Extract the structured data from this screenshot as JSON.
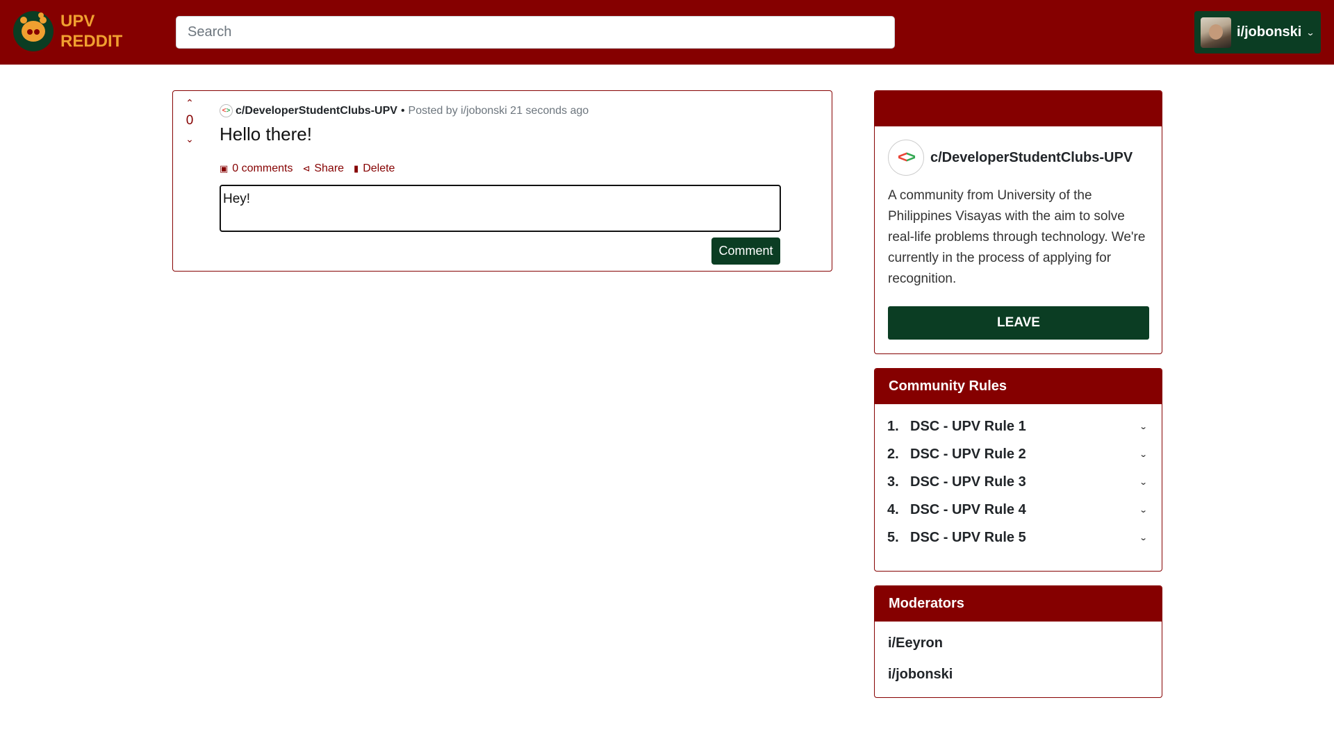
{
  "navbar": {
    "brand_line1": "UPV",
    "brand_line2": "REDDIT",
    "search_placeholder": "Search",
    "username": "i/jobonski"
  },
  "post": {
    "vote_count": "0",
    "community": "c/DeveloperStudentClubs-UPV",
    "bullet": "•",
    "posted_by": "Posted by i/jobonski 21 seconds ago",
    "title": "Hello there!",
    "actions": {
      "comments": "0 comments",
      "share": "Share",
      "delete": "Delete"
    },
    "comment_value": "Hey!",
    "comment_button": "Comment"
  },
  "about": {
    "community": "c/DeveloperStudentClubs-UPV",
    "description": "A community from University of the Philippines Visayas with the aim to solve real-life problems through technology. We're currently in the process of applying for recognition.",
    "leave_button": "LEAVE"
  },
  "rules": {
    "title": "Community Rules",
    "items": [
      {
        "num": "1.",
        "label": "DSC - UPV Rule 1"
      },
      {
        "num": "2.",
        "label": "DSC - UPV Rule 2"
      },
      {
        "num": "3.",
        "label": "DSC - UPV Rule 3"
      },
      {
        "num": "4.",
        "label": "DSC - UPV Rule 4"
      },
      {
        "num": "5.",
        "label": "DSC - UPV Rule 5"
      }
    ]
  },
  "moderators": {
    "title": "Moderators",
    "items": [
      "i/Eeyron",
      "i/jobonski"
    ]
  },
  "colors": {
    "primary_maroon": "#850000",
    "dark_green": "#0b3d23",
    "accent_gold": "#f0a030"
  },
  "icons": {
    "upvote": "chevron-up-icon",
    "downvote": "chevron-down-icon",
    "comments": "comment-icon",
    "share": "share-icon",
    "delete": "trash-icon",
    "rule_expand": "chevron-down-icon",
    "user_menu": "caret-down-icon"
  }
}
